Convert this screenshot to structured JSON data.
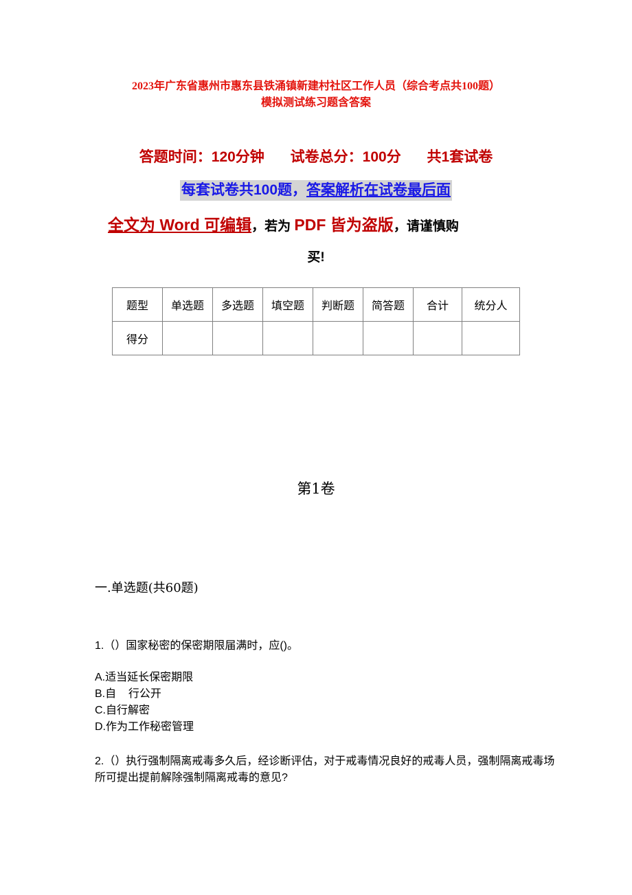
{
  "document": {
    "title_line1": "2023年广东省惠州市惠东县铁涌镇新建村社区工作人员（综合考点共100题）",
    "title_line2": "模拟测试练习题含答案",
    "meta": {
      "time": "答题时间：120分钟",
      "total_score": "试卷总分：100分",
      "sets": "共1套试卷"
    },
    "notice": {
      "part1": "每套试卷共100题，",
      "part2": "答案解析在试卷最后面"
    },
    "warning": {
      "editable": "全文为 Word 可编辑",
      "comma1": "，",
      "if_pdf": "若为 ",
      "pdf_piracy": "PDF 皆为盗版",
      "comma2": "，",
      "caution": "请谨慎购",
      "caution_end": "买!"
    },
    "score_table": {
      "headers": [
        "题型",
        "单选题",
        "多选题",
        "填空题",
        "判断题",
        "简答题",
        "合计",
        "统分人"
      ],
      "row": [
        "得分",
        "",
        "",
        "",
        "",
        "",
        "",
        ""
      ]
    },
    "volume_title": "第1卷",
    "section_title": "一.单选题(共60题)",
    "questions": [
      {
        "text": "1.（）国家秘密的保密期限届满时，应()。",
        "options": [
          "A.适当延长保密期限",
          "B.自    行公开",
          "C.自行解密",
          "D.作为工作秘密管理"
        ]
      },
      {
        "text": "2.（）执行强制隔离戒毒多久后，经诊断评估，对于戒毒情况良好的戒毒人员，强制隔离戒毒场所可提出提前解除强制隔离戒毒的意见?"
      }
    ]
  }
}
